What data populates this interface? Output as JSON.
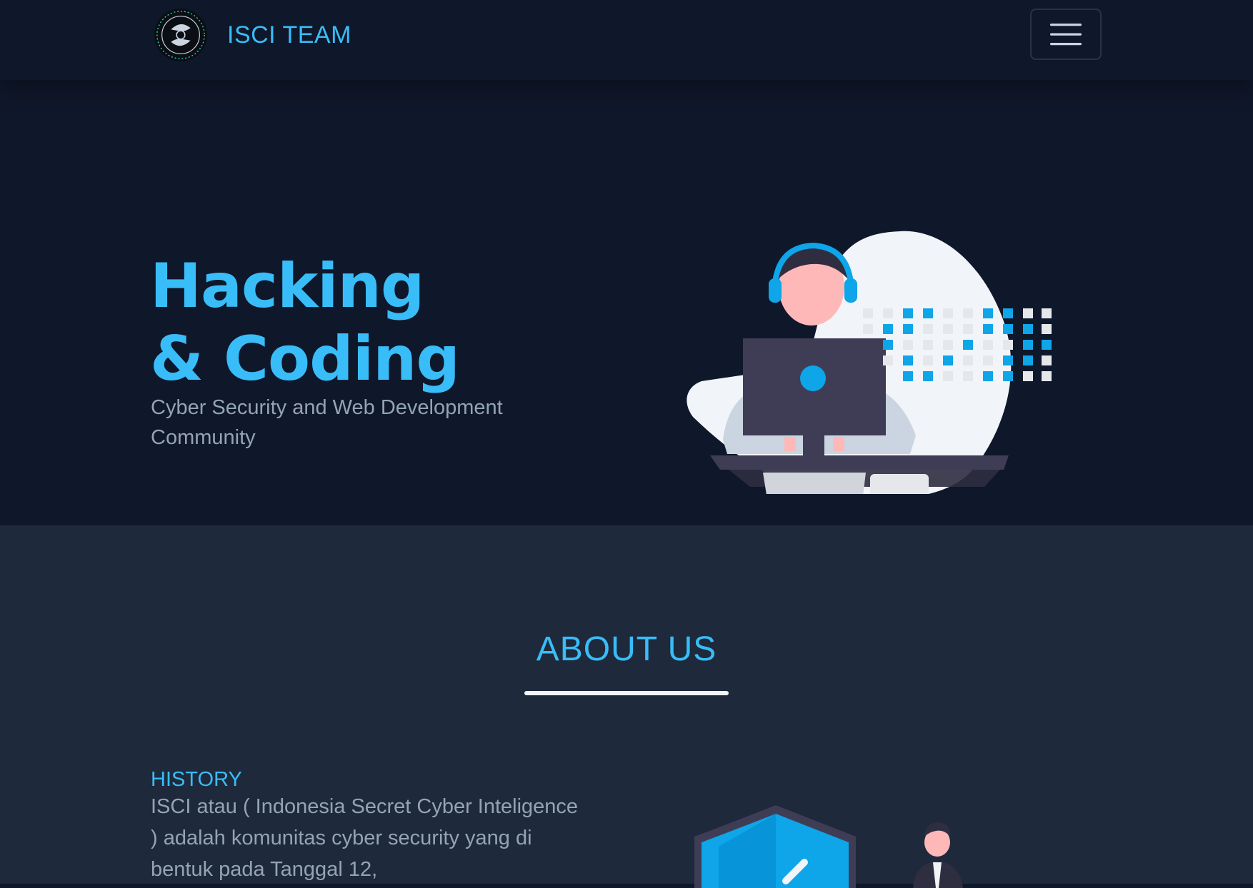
{
  "navbar": {
    "brand_name": "ISCI TEAM",
    "logo_icon": "isci-logo-icon",
    "menu_icon": "hamburger-menu-icon"
  },
  "hero": {
    "title_line1": "Hacking",
    "title_line2": "& Coding",
    "subtitle": "Cyber Security and Web Development Community",
    "illustration": "hacker-at-computer-illustration"
  },
  "about": {
    "title": "ABOUT US",
    "history_heading": "HISTORY",
    "history_text": "ISCI atau ( Indonesia Secret Cyber Inteligence ) adalah komunitas cyber security yang di bentuk pada Tanggal 12,",
    "illustration": "security-shield-illustration"
  },
  "colors": {
    "accent": "#38bdf8",
    "background": "#0f172a",
    "section_alt": "#1e293b",
    "muted_text": "#94a3b8"
  }
}
